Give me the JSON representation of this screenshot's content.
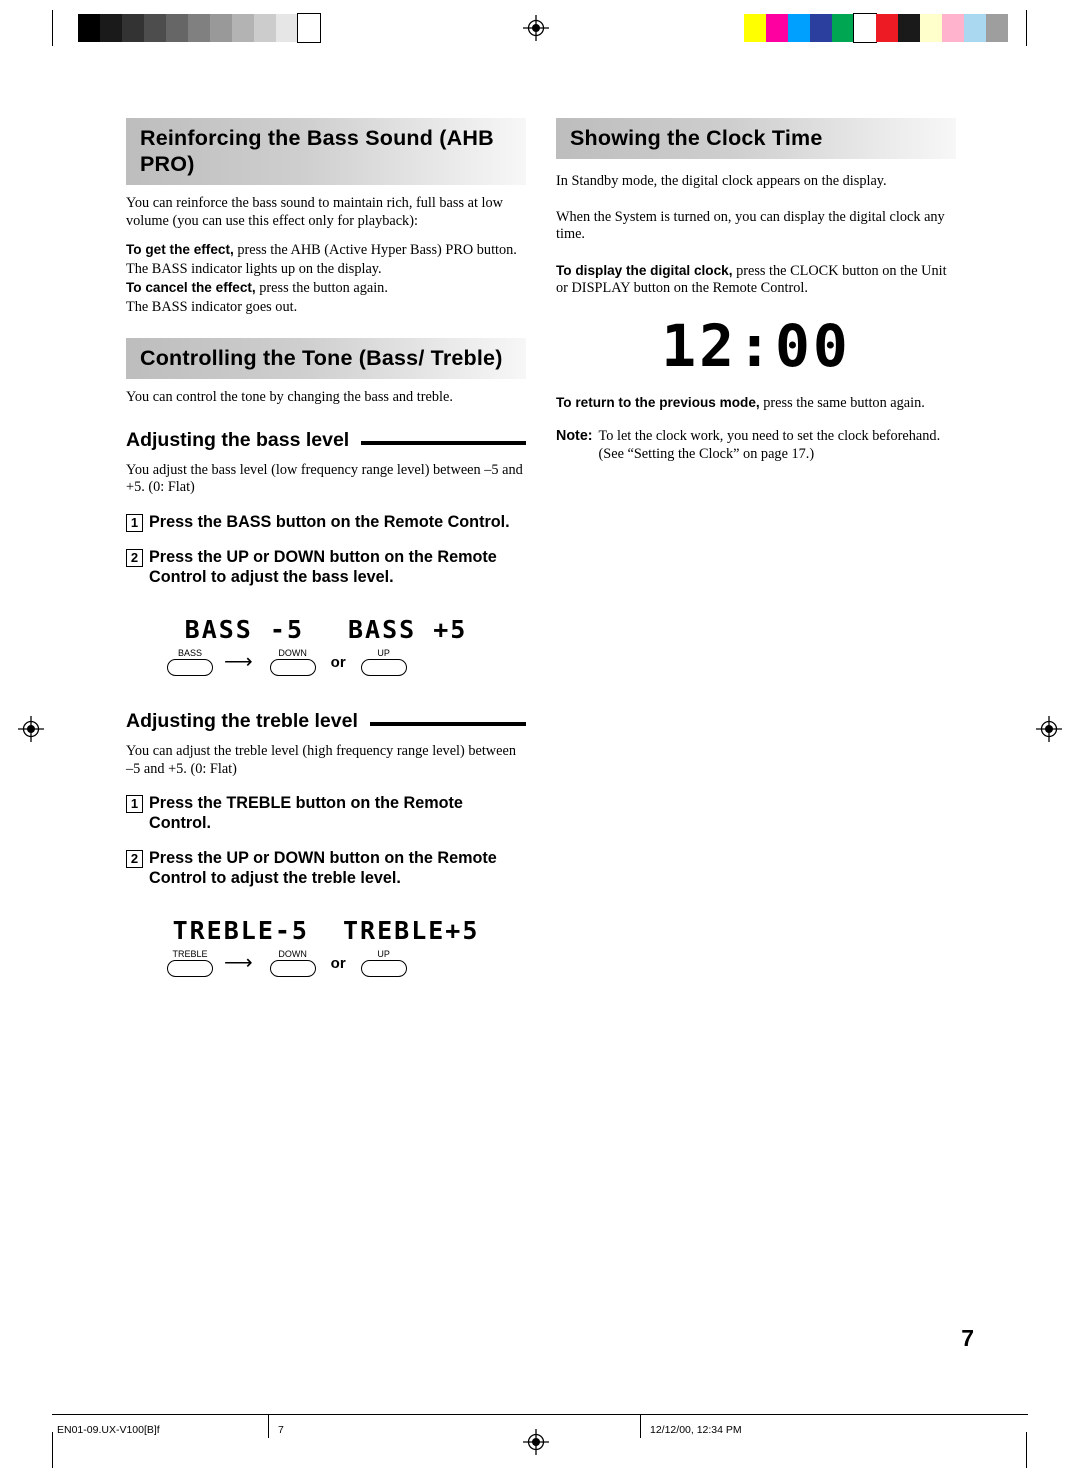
{
  "document": {
    "page_number": "7",
    "footer": {
      "file_id": "EN01-09.UX-V100[B]f",
      "page": "7",
      "timestamp": "12/12/00, 12:34 PM"
    }
  },
  "left_column": {
    "section1": {
      "heading": "Reinforcing the Bass Sound (AHB PRO)",
      "p1": "You can reinforce the bass sound to maintain rich, full bass at low volume (you can use this effect only for playback):",
      "p2_bold": "To get the effect,",
      "p2_rest": " press the AHB (Active Hyper Bass) PRO button.",
      "p3": "The BASS indicator lights up on the display.",
      "p4_bold": "To cancel the effect,",
      "p4_rest": " press the button again.",
      "p5": "The BASS indicator goes out."
    },
    "section2": {
      "heading": "Controlling the Tone (Bass/ Treble)",
      "p1": "You can control the tone by changing the bass and treble.",
      "bass": {
        "subheading": "Adjusting the bass level",
        "p1": "You adjust the bass level (low frequency range level) between –5 and +5. (0: Flat)",
        "steps": [
          {
            "num": "1",
            "text": "Press the BASS button on the Remote Control."
          },
          {
            "num": "2",
            "text": "Press the UP or DOWN button on the Remote Control to adjust the bass level."
          }
        ],
        "lcd_left": "BASS -5",
        "lcd_right": "BASS +5",
        "keys": {
          "source": "BASS",
          "down": "DOWN",
          "or": "or",
          "up": "UP"
        }
      },
      "treble": {
        "subheading": "Adjusting the treble level",
        "p1": "You can adjust the treble level (high frequency range level) between –5 and +5. (0: Flat)",
        "steps": [
          {
            "num": "1",
            "text": "Press the TREBLE button on the Remote Control."
          },
          {
            "num": "2",
            "text": "Press the UP or DOWN button on the Remote Control to adjust the treble level."
          }
        ],
        "lcd_left": "TREBLE-5",
        "lcd_right": "TREBLE+5",
        "keys": {
          "source": "TREBLE",
          "down": "DOWN",
          "or": "or",
          "up": "UP"
        }
      }
    }
  },
  "right_column": {
    "heading": "Showing the Clock Time",
    "p1": "In Standby mode, the digital clock appears on the display.",
    "p2": "When the System is turned on, you can display the digital clock any time.",
    "p3_bold": "To display the digital clock,",
    "p3_rest": " press the CLOCK button on the Unit or DISPLAY button on the Remote Control.",
    "clock_display": "12:00",
    "p4_bold": "To return to the previous mode,",
    "p4_rest": " press the same button again.",
    "note_label": "Note:",
    "note_text": "To let the clock work, you need to set the clock beforehand. (See “Setting the Clock” on page 17.)"
  },
  "print_marks": {
    "grayscale_swatches": [
      "#000000",
      "#1a1a1a",
      "#333333",
      "#4d4d4d",
      "#666666",
      "#808080",
      "#999999",
      "#b3b3b3",
      "#cccccc",
      "#e6e6e6",
      "#ffffff"
    ],
    "color_swatches": [
      "#ffff00",
      "#ff00a0",
      "#00a0ff",
      "#2b3f9e",
      "#00a651",
      "#ffffff",
      "#ed1c24",
      "#1a1a1a",
      "#ffffcc",
      "#ffb3cc",
      "#a9d8f0",
      "#9e9e9e"
    ]
  }
}
